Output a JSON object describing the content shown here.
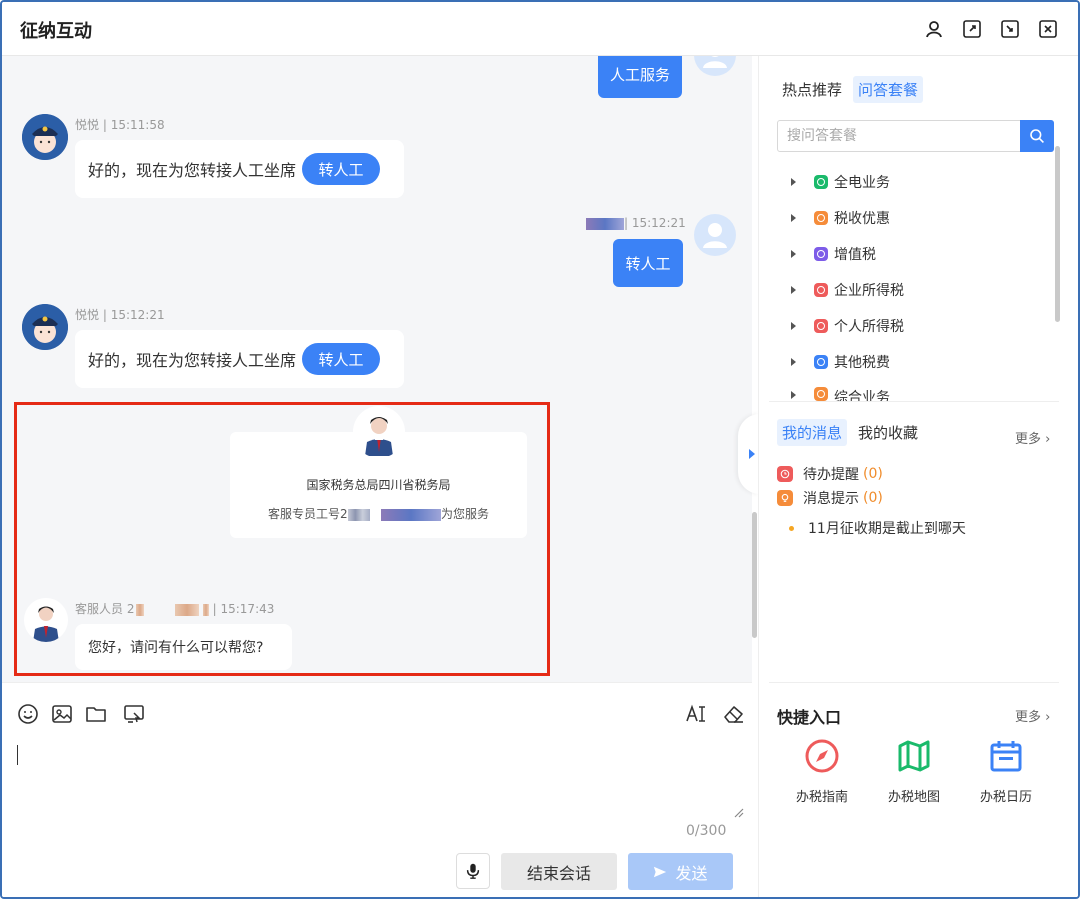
{
  "window": {
    "title": "征纳互动"
  },
  "chat": {
    "top_user_bubble": "人工服务",
    "messages": [
      {
        "sender": "悦悦",
        "time": "15:11:58",
        "text": "好的，现在为您转接人工坐席",
        "button": "转人工"
      },
      {
        "sender_time": "| 15:12:21",
        "text": "转人工"
      },
      {
        "sender": "悦悦",
        "time": "15:12:21",
        "text": "好的，现在为您转接人工坐席",
        "button": "转人工"
      }
    ],
    "agent_card": {
      "org": "国家税务总局四川省税务局",
      "prefix": "客服专员工号2",
      "suffix": "为您服务"
    },
    "agent_msg": {
      "sender": "客服人员 2",
      "time": "| 15:17:43",
      "text": "您好，请问有什么可以帮您?"
    }
  },
  "input": {
    "counter": "0/300",
    "end_label": "结束会话",
    "send_label": "发送"
  },
  "right": {
    "tabs": [
      "热点推荐",
      "问答套餐"
    ],
    "search_placeholder": "搜问答套餐",
    "categories": [
      {
        "label": "全电业务",
        "color": "#1aba6b"
      },
      {
        "label": "税收优惠",
        "color": "#f58c3a"
      },
      {
        "label": "增值税",
        "color": "#7d5ce8"
      },
      {
        "label": "企业所得税",
        "color": "#ee5b5b"
      },
      {
        "label": "个人所得税",
        "color": "#ee5b5b"
      },
      {
        "label": "其他税费",
        "color": "#3b82f6"
      },
      {
        "label": "综合业务",
        "color": "#f58c3a"
      }
    ],
    "msg_tabs": [
      "我的消息",
      "我的收藏"
    ],
    "more": "更多",
    "reminders": [
      {
        "label": "待办提醒",
        "count": "(0)",
        "color": "#ee5b5b"
      },
      {
        "label": "消息提示",
        "count": "(0)",
        "color": "#f58c3a"
      }
    ],
    "notice": "11月征收期是截止到哪天",
    "quick": {
      "title": "快捷入口",
      "more": "更多",
      "items": [
        {
          "label": "办税指南",
          "icon": "compass-icon",
          "color": "#ee5b5b"
        },
        {
          "label": "办税地图",
          "icon": "map-icon",
          "color": "#1aba6b"
        },
        {
          "label": "办税日历",
          "icon": "calendar-icon",
          "color": "#3b82f6"
        }
      ]
    }
  }
}
